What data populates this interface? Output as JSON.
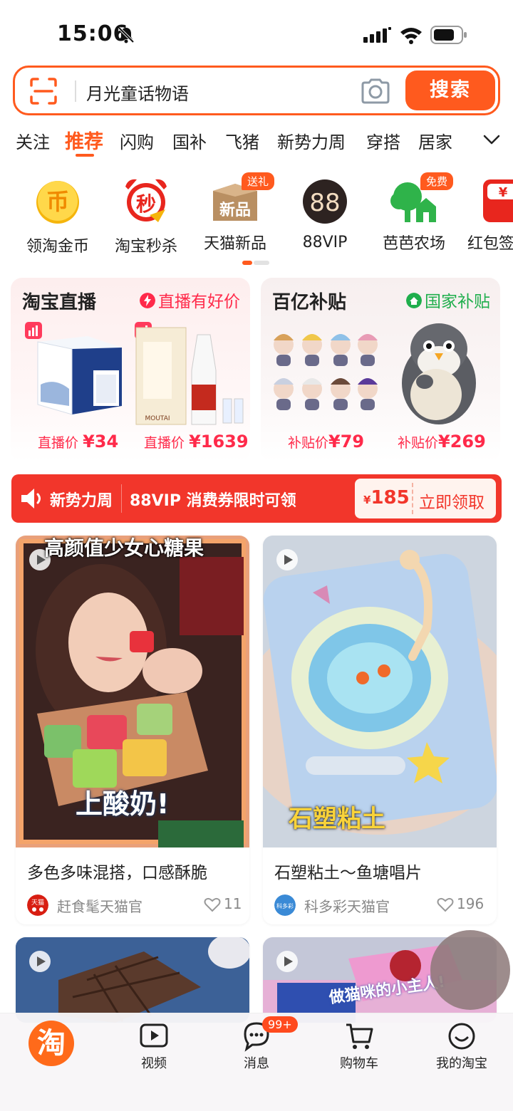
{
  "status_bar": {
    "time": "15:06"
  },
  "search": {
    "query": "月光童话物语",
    "button_label": "搜索"
  },
  "tabs": [
    "关注",
    "推荐",
    "闪购",
    "国补",
    "飞猪",
    "新势力周",
    "穿搭",
    "居家"
  ],
  "quick_icons": [
    {
      "label": "领淘金币",
      "icon": "gold-coin-icon"
    },
    {
      "label": "淘宝秒杀",
      "icon": "flash-sale-alarm-icon"
    },
    {
      "label": "天猫新品",
      "icon": "new-product-box-icon",
      "badge": "送礼"
    },
    {
      "label": "88VIP",
      "icon": "vip-88-icon"
    },
    {
      "label": "芭芭农场",
      "icon": "farm-tree-icon",
      "badge": "免费"
    },
    {
      "label": "红包签",
      "icon": "red-packet-icon"
    }
  ],
  "promo_live": {
    "title": "淘宝直播",
    "tag": "直播有好价",
    "items": [
      {
        "price_label": "直播价",
        "price": "¥34"
      },
      {
        "price_label": "直播价",
        "price": "¥1639"
      }
    ]
  },
  "promo_subsidy": {
    "title": "百亿补贴",
    "tag": "国家补贴",
    "items": [
      {
        "price_label": "补贴价",
        "price": "¥79"
      },
      {
        "price_label": "补贴价",
        "price": "¥269"
      }
    ]
  },
  "banner": {
    "label": "新势力周",
    "text": "88VIP 消费券限时可领",
    "coupon_currency": "¥",
    "coupon_value": "185",
    "action": "立即领取"
  },
  "feed": [
    {
      "overlay_top": "高颜值少女心糖果",
      "overlay_bottom": "上酸奶!",
      "title": "多色多味混搭，口感酥脆",
      "shop": "赶食髦天猫官",
      "likes": "11"
    },
    {
      "overlay_bottom": "石塑粘土",
      "title": "石塑粘土～鱼塘唱片",
      "shop": "科多彩天猫官",
      "likes": "196"
    },
    {
      "overlay_bottom": ""
    },
    {
      "overlay_bottom": "做猫咪的小主人!"
    }
  ],
  "bottom_nav": {
    "home": "淘",
    "items": [
      "视频",
      "消息",
      "购物车",
      "我的淘宝"
    ],
    "message_badge": "99+"
  },
  "colors": {
    "accent": "#ff5a1e",
    "price_red": "#ff2a4a",
    "banner_red": "#f2362b",
    "green": "#1fae4c"
  }
}
